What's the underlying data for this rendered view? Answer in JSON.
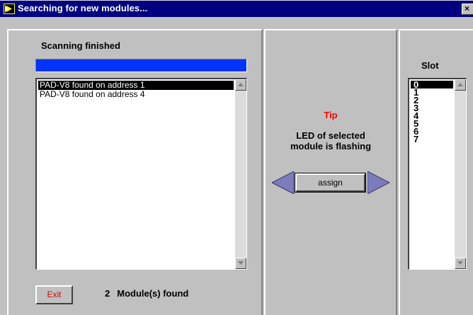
{
  "window": {
    "title": "Searching for new modules...",
    "close_glyph": "×"
  },
  "scan": {
    "status": "Scanning finished",
    "progress_percent": 100,
    "modules": [
      {
        "label": "PAD-V8 found on address  1",
        "selected": true
      },
      {
        "label": "PAD-V8 found on address  4",
        "selected": false
      }
    ],
    "exit_label": "Exit",
    "found_count": "2",
    "found_label": "Module(s) found"
  },
  "center": {
    "tip_title": "Tip",
    "tip_line1": "LED of selected",
    "tip_line2": "module is flashing",
    "assign_label": "assign",
    "icons": [
      "arrow-left-icon",
      "arrow-right-icon"
    ]
  },
  "slots": {
    "header": "Slot",
    "items": [
      "0",
      "1",
      "2",
      "3",
      "4",
      "5",
      "6",
      "7"
    ],
    "selected": "0"
  },
  "colors": {
    "titlebar": "#000080",
    "progress": "#0033ff",
    "tip": "#ff0000",
    "exit_text": "#e00000",
    "arrow": "#7b7bbd"
  }
}
